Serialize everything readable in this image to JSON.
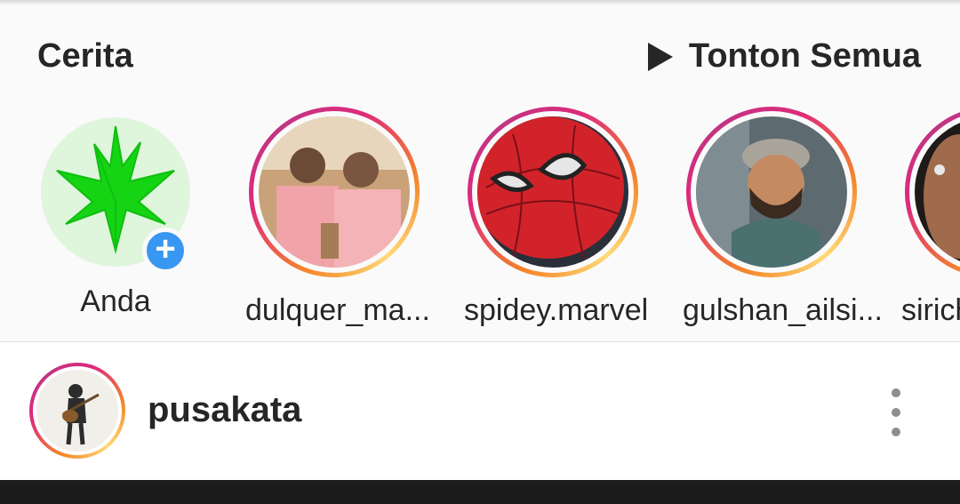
{
  "stories": {
    "title": "Cerita",
    "watch_all_label": "Tonton Semua",
    "items": [
      {
        "label": "Anda",
        "own": true
      },
      {
        "label": "dulquer_ma..."
      },
      {
        "label": "spidey.marvel"
      },
      {
        "label": "gulshan_ailsi..."
      },
      {
        "label": "sirich"
      }
    ]
  },
  "post": {
    "username": "pusakata"
  },
  "colors": {
    "text": "#262626",
    "add_badge": "#3897f0",
    "ring_gradient": [
      "#f58529",
      "#dd2a7b",
      "#c13584",
      "#feda77"
    ],
    "more_dots": "#8e8e8e"
  }
}
